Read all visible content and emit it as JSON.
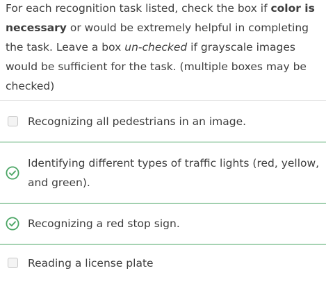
{
  "question": {
    "part1": "For each recognition task listed, check the box if ",
    "bold": "color is necessary",
    "part2": " or would be extremely helpful in completing the task. Leave a box ",
    "italic": "un-checked",
    "part3": " if grayscale images would be sufficient for the task. (multiple boxes may be checked)"
  },
  "options": [
    {
      "label": "Recognizing all pedestrians in an image.",
      "checked": false
    },
    {
      "label": "Identifying different types of traffic lights (red, yellow, and green).",
      "checked": true
    },
    {
      "label": "Recognizing a red stop sign.",
      "checked": true
    },
    {
      "label": "Reading a license plate",
      "checked": false
    }
  ],
  "colors": {
    "check_green": "#4aa564",
    "divider": "#e3e3e3"
  }
}
